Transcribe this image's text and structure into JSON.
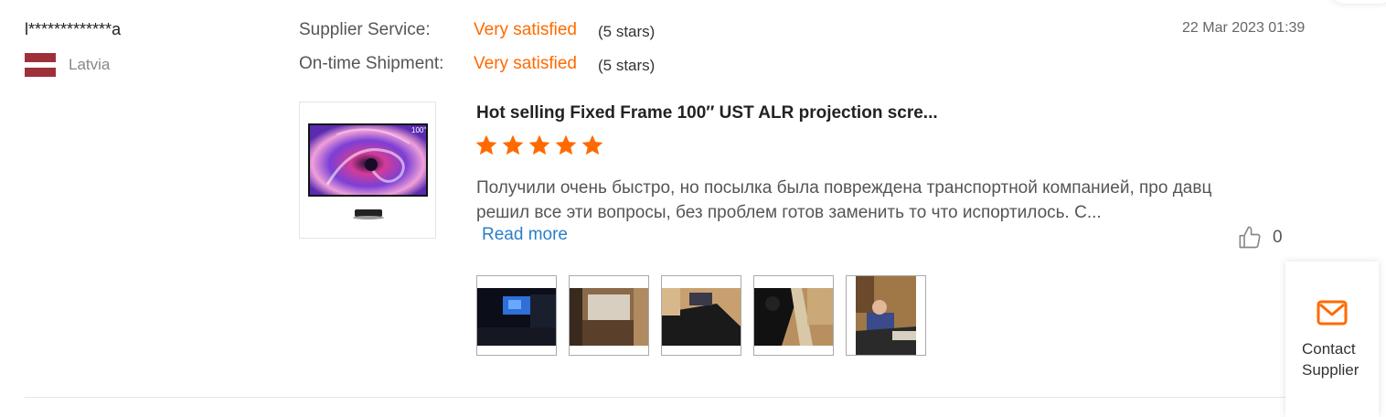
{
  "reviewer": {
    "name": "l*************a",
    "country": "Latvia",
    "flag_colors": {
      "red": "#9e3039",
      "white": "#ffffff"
    }
  },
  "ratings": [
    {
      "label": "Supplier Service:",
      "value": "Very satisfied",
      "stars_text": "(5 stars)"
    },
    {
      "label": "On-time Shipment:",
      "value": "Very satisfied",
      "stars_text": "(5 stars)"
    }
  ],
  "date": "22 Mar 2023 01:39",
  "product": {
    "title": "Hot selling Fixed Frame 100″ UST ALR projection scre...",
    "rating_stars": 5,
    "thumb_badge": "100\"",
    "image": "projection-screen-with-projector"
  },
  "review": {
    "text": "Получили очень быстро, но посылка была повреждена транспортной компанией, про давц решил все эти вопросы, без проблем готов заменить то что испортилось. С...",
    "read_more_label": "Read more"
  },
  "likes": {
    "icon": "thumbs-up-icon",
    "count": "0"
  },
  "photos": [
    "dark-home-theater",
    "beige-living-room-screen",
    "screen-installation-floor",
    "screen-frame-on-sofa",
    "person-assembling-frame"
  ],
  "contact": {
    "label": "Contact Supplier",
    "icon": "envelope-icon"
  },
  "colors": {
    "accent": "#ff6a00",
    "link": "#2a7fc9"
  }
}
